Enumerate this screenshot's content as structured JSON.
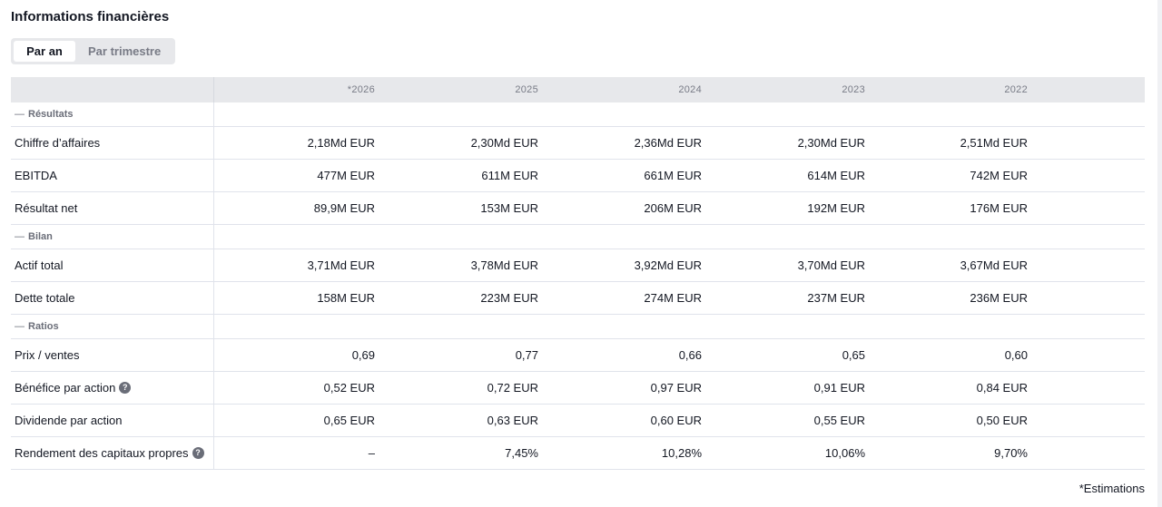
{
  "title": "Informations financières",
  "toggle": {
    "active": "Par an",
    "inactive": "Par trimestre"
  },
  "columns": [
    "*2026",
    "2025",
    "2024",
    "2023",
    "2022"
  ],
  "sections": [
    {
      "name": "Résultats",
      "rows": [
        {
          "label": "Chiffre d’affaires",
          "help": false,
          "values": [
            "2,18Md EUR",
            "2,30Md EUR",
            "2,36Md EUR",
            "2,30Md EUR",
            "2,51Md EUR"
          ]
        },
        {
          "label": "EBITDA",
          "help": false,
          "values": [
            "477M EUR",
            "611M EUR",
            "661M EUR",
            "614M EUR",
            "742M EUR"
          ]
        },
        {
          "label": "Résultat net",
          "help": false,
          "values": [
            "89,9M EUR",
            "153M EUR",
            "206M EUR",
            "192M EUR",
            "176M EUR"
          ]
        }
      ]
    },
    {
      "name": "Bilan",
      "rows": [
        {
          "label": "Actif total",
          "help": false,
          "values": [
            "3,71Md EUR",
            "3,78Md EUR",
            "3,92Md EUR",
            "3,70Md EUR",
            "3,67Md EUR"
          ]
        },
        {
          "label": "Dette totale",
          "help": false,
          "values": [
            "158M EUR",
            "223M EUR",
            "274M EUR",
            "237M EUR",
            "236M EUR"
          ]
        }
      ]
    },
    {
      "name": "Ratios",
      "rows": [
        {
          "label": "Prix / ventes",
          "help": false,
          "values": [
            "0,69",
            "0,77",
            "0,66",
            "0,65",
            "0,60"
          ]
        },
        {
          "label": "Bénéfice par action",
          "help": true,
          "values": [
            "0,52 EUR",
            "0,72 EUR",
            "0,97 EUR",
            "0,91 EUR",
            "0,84 EUR"
          ]
        },
        {
          "label": "Dividende par action",
          "help": false,
          "values": [
            "0,65 EUR",
            "0,63 EUR",
            "0,60 EUR",
            "0,55 EUR",
            "0,50 EUR"
          ]
        },
        {
          "label": "Rendement des capitaux propres",
          "help": true,
          "values": [
            "–",
            "7,45%",
            "10,28%",
            "10,06%",
            "9,70%"
          ]
        }
      ]
    }
  ],
  "section_dash": "—",
  "help_glyph": "?",
  "footnote": "*Estimations"
}
